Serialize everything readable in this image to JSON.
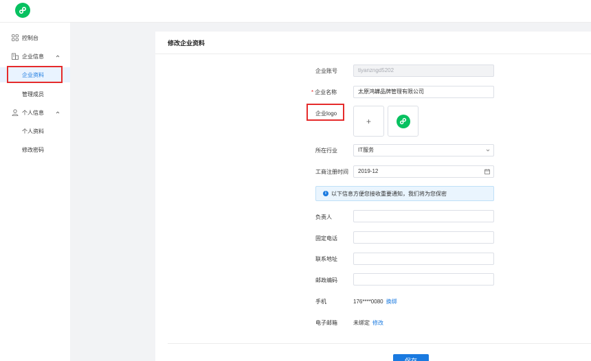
{
  "sidebar": {
    "dashboard": "控制台",
    "enterprise_info": "企业信息",
    "enterprise_profile": "企业资料",
    "manage_members": "管理成员",
    "personal_info": "个人信息",
    "personal_profile": "个人资料",
    "change_password": "修改密码"
  },
  "panel": {
    "title": "修改企业资料"
  },
  "form": {
    "account_label": "企业账号",
    "account_value": "tiyanzngd5202",
    "name_label": "企业名称",
    "name_required": "*",
    "name_value": "太原鸿韡品牌管理有限公司",
    "logo_label": "企业logo",
    "upload_plus": "+",
    "industry_label": "所在行业",
    "industry_value": "IT服务",
    "reg_time_label": "工商注册时间",
    "reg_time_value": "2019-12",
    "notice_icon": "i",
    "notice_text": "以下信息方便您接收重要通知，我们将为您保密",
    "contact_label": "负责人",
    "phone_label": "固定电话",
    "address_label": "联系地址",
    "zip_label": "邮政编码",
    "mobile_label": "手机",
    "mobile_value": "176****0080",
    "mobile_action": "换绑",
    "email_label": "电子邮箱",
    "email_value": "未绑定",
    "email_action": "修改",
    "save_label": "保存"
  },
  "colors": {
    "brand_green": "#07c160",
    "link_blue": "#1a7ae0",
    "highlight_red": "#e52a2a"
  }
}
